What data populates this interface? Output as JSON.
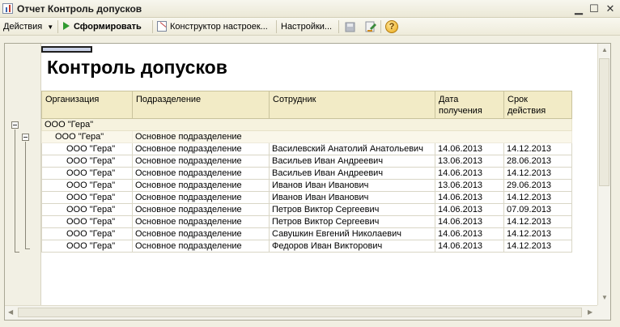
{
  "window": {
    "title": "Отчет  Контроль допусков"
  },
  "toolbar": {
    "actions_label": "Действия",
    "generate_label": "Сформировать",
    "constructor_label": "Конструктор настроек...",
    "settings_label": "Настройки...",
    "help_label": "?"
  },
  "report": {
    "title": "Контроль допусков",
    "headers": {
      "org": "Организация",
      "dept": "Подразделение",
      "employee": "Сотрудник",
      "date_line1": "Дата",
      "date_line2": "получения",
      "term_line1": "Срок",
      "term_line2": "действия"
    },
    "group1": {
      "label": "ООО \"Гера\""
    },
    "group2": {
      "org": "ООО \"Гера\"",
      "dept": "Основное подразделение"
    },
    "rows": [
      {
        "org": "ООО \"Гера\"",
        "dept": "Основное подразделение",
        "employee": "Василевский Анатолий Анатольевич",
        "date": "14.06.2013",
        "term": "14.12.2013"
      },
      {
        "org": "ООО \"Гера\"",
        "dept": "Основное подразделение",
        "employee": "Васильев Иван Андреевич",
        "date": "13.06.2013",
        "term": "28.06.2013"
      },
      {
        "org": "ООО \"Гера\"",
        "dept": "Основное подразделение",
        "employee": "Васильев Иван Андреевич",
        "date": "14.06.2013",
        "term": "14.12.2013"
      },
      {
        "org": "ООО \"Гера\"",
        "dept": "Основное подразделение",
        "employee": "Иванов Иван Иванович",
        "date": "13.06.2013",
        "term": "29.06.2013"
      },
      {
        "org": "ООО \"Гера\"",
        "dept": "Основное подразделение",
        "employee": "Иванов Иван Иванович",
        "date": "14.06.2013",
        "term": "14.12.2013"
      },
      {
        "org": "ООО \"Гера\"",
        "dept": "Основное подразделение",
        "employee": "Петров Виктор Сергеевич",
        "date": "14.06.2013",
        "term": "07.09.2013"
      },
      {
        "org": "ООО \"Гера\"",
        "dept": "Основное подразделение",
        "employee": "Петров Виктор Сергеевич",
        "date": "14.06.2013",
        "term": "14.12.2013"
      },
      {
        "org": "ООО \"Гера\"",
        "dept": "Основное подразделение",
        "employee": "Савушкин Евгений Николаевич",
        "date": "14.06.2013",
        "term": "14.12.2013"
      },
      {
        "org": "ООО \"Гера\"",
        "dept": "Основное подразделение",
        "employee": "Федоров Иван Викторович",
        "date": "14.06.2013",
        "term": "14.12.2013"
      }
    ]
  },
  "icons": [
    "report-icon",
    "minimize-icon",
    "maximize-icon",
    "close-icon",
    "play-icon",
    "settings-constructor-icon",
    "save-icon",
    "load-icon",
    "help-icon",
    "collapse-icon"
  ]
}
